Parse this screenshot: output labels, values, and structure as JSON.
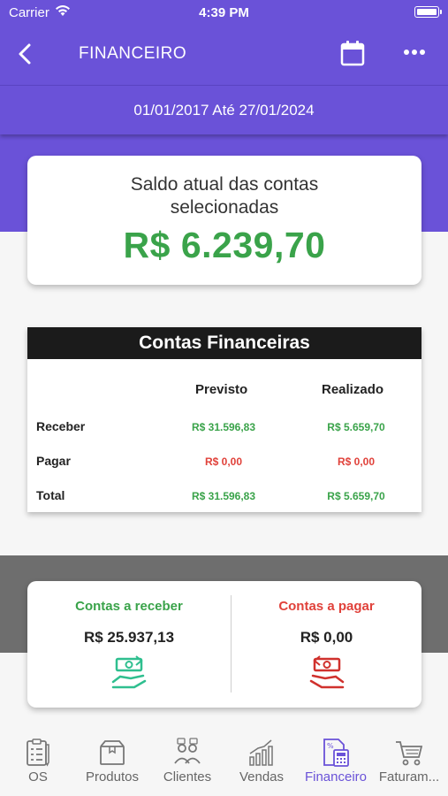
{
  "status_bar": {
    "carrier": "Carrier",
    "time": "4:39 PM"
  },
  "nav": {
    "title": "FINANCEIRO",
    "icons": [
      "back-chevron-icon",
      "calendar-icon",
      "more-dots-icon"
    ]
  },
  "date_range": "01/01/2017 Até 27/01/2024",
  "balance": {
    "label": "Saldo atual das contas selecionadas",
    "amount": "R$ 6.239,70"
  },
  "accounts": {
    "title": "Contas Financeiras",
    "columns": [
      "Previsto",
      "Realizado"
    ],
    "rows": [
      {
        "label": "Receber",
        "previsto": "R$ 31.596,83",
        "realizado": "R$ 5.659,70"
      },
      {
        "label": "Pagar",
        "previsto": "R$ 0,00",
        "realizado": "R$ 0,00"
      },
      {
        "label": "Total",
        "previsto": "R$ 31.596,83",
        "realizado": "R$ 5.659,70"
      }
    ]
  },
  "summary": {
    "receivable": {
      "title": "Contas a receber",
      "value": "R$ 25.937,13",
      "icon": "receive-money-icon"
    },
    "payable": {
      "title": "Contas a pagar",
      "value": "R$ 0,00",
      "icon": "pay-money-icon"
    }
  },
  "tabs": [
    {
      "label": "OS",
      "icon": "clipboard-checklist-icon"
    },
    {
      "label": "Produtos",
      "icon": "box-icon"
    },
    {
      "label": "Clientes",
      "icon": "people-icon"
    },
    {
      "label": "Vendas",
      "icon": "chart-bars-icon"
    },
    {
      "label": "Financeiro",
      "icon": "calculator-document-icon",
      "active": true
    },
    {
      "label": "Faturam...",
      "icon": "shopping-cart-icon"
    }
  ],
  "colors": {
    "primary": "#6a52d8",
    "positive": "#3aa34a",
    "negative": "#e0413a",
    "receivable_icon": "#2fbf8f",
    "payable_icon": "#d0312d"
  }
}
